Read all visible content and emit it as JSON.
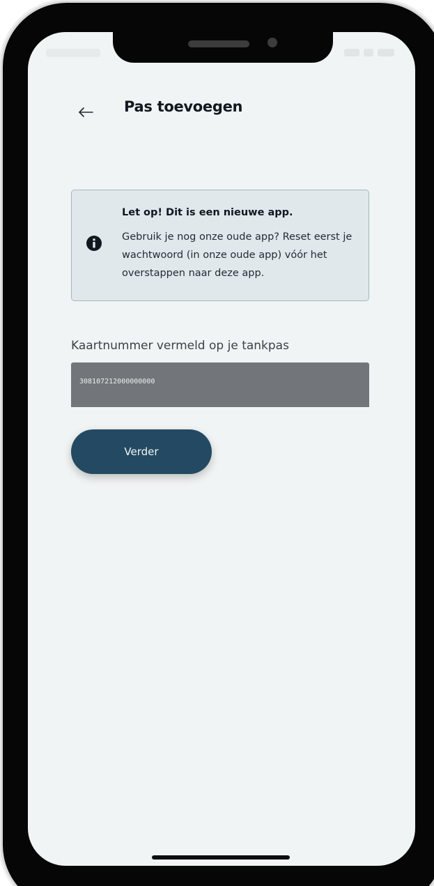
{
  "header": {
    "title": "Pas toevoegen",
    "back_icon": "arrow-left-icon"
  },
  "notice": {
    "icon": "info-circle-icon",
    "title": "Let op! Dit is een nieuwe app.",
    "body": "Gebruik je nog onze oude app? Reset eerst je wachtwoord (in onze oude app) vóór het overstappen naar deze app."
  },
  "card_field": {
    "label": "Kaartnummer vermeld op je tankpas",
    "value": "308107212000000000"
  },
  "actions": {
    "next_label": "Verder"
  },
  "colors": {
    "screen_background": "#f1f4f4",
    "notice_background": "#e0e8ec",
    "notice_border": "#a6b7bf",
    "input_background": "#72767a",
    "primary_button": "#234a62"
  }
}
